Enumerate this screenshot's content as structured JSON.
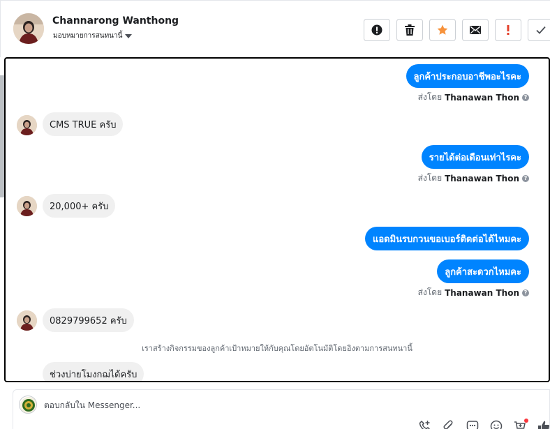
{
  "header": {
    "contact_name": "Channarong Wanthong",
    "assign_label": "มอบหมายการสนทนานี้"
  },
  "actions": [
    {
      "name": "spam-button",
      "icon": "alert-circle-icon"
    },
    {
      "name": "delete-button",
      "icon": "trash-icon"
    },
    {
      "name": "star-button",
      "icon": "star-icon",
      "color": "#f7923b"
    },
    {
      "name": "mark-unread-button",
      "icon": "envelope-icon"
    },
    {
      "name": "follow-up-button",
      "icon": "exclamation-icon",
      "color": "#e4412b"
    },
    {
      "name": "done-button",
      "icon": "check-icon"
    }
  ],
  "messages": {
    "out1": "ลูกค้าประกอบอาชีพอะไรคะ",
    "in1": "CMS TRUE ครับ",
    "out2": "รายได้ต่อเดือนเท่าไรคะ",
    "in2": "20,000+ ครับ",
    "out3": "แอดมินรบกวนขอเบอร์ติดต่อได้ไหมคะ",
    "out4": "ลูกค้าสะดวกไหมคะ",
    "in3": "0829799652 ครับ",
    "in4": "ช่วงบ่ายโมงกฌได้ครับ"
  },
  "sent_by": {
    "prefix": "ส่งโดย",
    "name": "Thanawan Thon",
    "help": "?"
  },
  "system_note": "เราสร้างกิจกรรมของลูกค้าเป้าหมายให้กับคุณโดยอัตโนมัติโดยอิงตามการสนทนานี้",
  "composer": {
    "placeholder": "ตอบกลับใน Messenger..."
  },
  "colors": {
    "outgoing_bubble": "#0084ff",
    "incoming_bubble": "#f0f0f0",
    "star": "#f7923b",
    "flag": "#e4412b"
  }
}
